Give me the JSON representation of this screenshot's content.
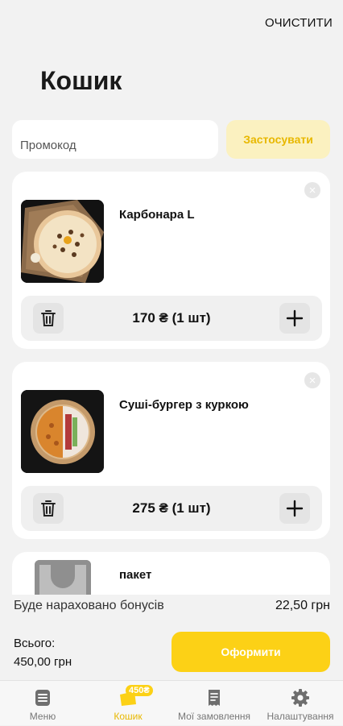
{
  "header": {
    "clear_label": "ОЧИСТИТИ",
    "title": "Кошик"
  },
  "promo": {
    "placeholder": "Промокод",
    "apply_label": "Застосувати"
  },
  "items": [
    {
      "name": "Карбонара L",
      "price": "170 ₴ (1 шт)"
    },
    {
      "name": "Суші-бургер  з куркою",
      "price": "275 ₴ (1 шт)"
    },
    {
      "name": "пакет"
    }
  ],
  "summary": {
    "bonus_label": "Буде нараховано бонусів",
    "bonus_value": "22,50 грн",
    "total_label": "Всього:",
    "total_value": "450,00 грн",
    "checkout_label": "Оформити"
  },
  "nav": {
    "items": [
      {
        "label": "Меню",
        "icon": "menu-icon"
      },
      {
        "label": "Кошик",
        "icon": "cart-icon",
        "badge": "450₴",
        "active": true
      },
      {
        "label": "Мої замовлення",
        "icon": "receipt-icon"
      },
      {
        "label": "Налаштування",
        "icon": "gear-icon"
      }
    ]
  },
  "colors": {
    "accent": "#fcd116",
    "accent_text": "#e8b800",
    "apply_bg": "#fbf1c0",
    "background": "#f2f2f2"
  }
}
